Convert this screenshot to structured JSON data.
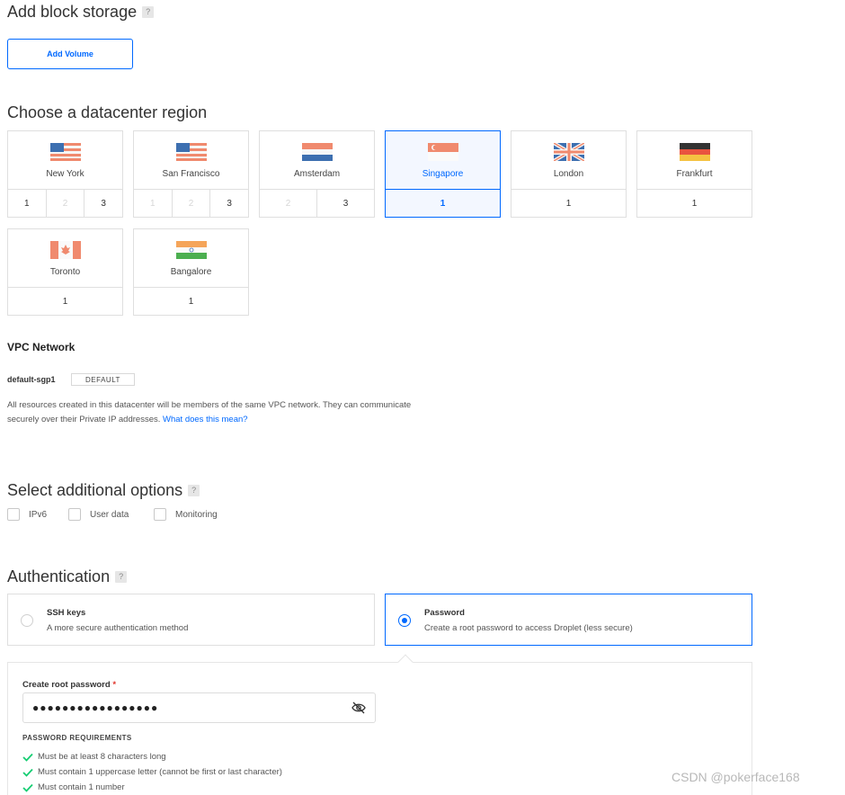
{
  "block_storage": {
    "title": "Add block storage",
    "help": "?",
    "add_volume_label": "Add Volume"
  },
  "datacenter": {
    "title": "Choose a datacenter region",
    "regions": [
      {
        "name": "New York",
        "flag": "us-flag",
        "numbers": [
          "1",
          "2",
          "3"
        ],
        "disabled": [
          false,
          true,
          false
        ],
        "selected": false
      },
      {
        "name": "San Francisco",
        "flag": "us-flag",
        "numbers": [
          "1",
          "2",
          "3"
        ],
        "disabled": [
          true,
          true,
          false
        ],
        "selected": false
      },
      {
        "name": "Amsterdam",
        "flag": "netherlands-flag",
        "numbers": [
          "2",
          "3"
        ],
        "disabled": [
          true,
          false
        ],
        "selected": false
      },
      {
        "name": "Singapore",
        "flag": "singapore-flag",
        "numbers": [
          "1"
        ],
        "disabled": [
          false
        ],
        "selected": true
      },
      {
        "name": "London",
        "flag": "uk-flag",
        "numbers": [
          "1"
        ],
        "disabled": [
          false
        ],
        "selected": false
      },
      {
        "name": "Frankfurt",
        "flag": "germany-flag",
        "numbers": [
          "1"
        ],
        "disabled": [
          false
        ],
        "selected": false
      },
      {
        "name": "Toronto",
        "flag": "canada-flag",
        "numbers": [
          "1"
        ],
        "disabled": [
          false
        ],
        "selected": false
      },
      {
        "name": "Bangalore",
        "flag": "india-flag",
        "numbers": [
          "1"
        ],
        "disabled": [
          false
        ],
        "selected": false
      }
    ]
  },
  "vpc": {
    "title": "VPC Network",
    "network_name": "default-sgp1",
    "badge": "DEFAULT",
    "description": "All resources created in this datacenter will be members of the same VPC network. They can communicate securely over their Private IP addresses.",
    "link": "What does this mean?"
  },
  "options": {
    "title": "Select additional options",
    "help": "?",
    "items": [
      "IPv6",
      "User data",
      "Monitoring"
    ]
  },
  "auth": {
    "title": "Authentication",
    "help": "?",
    "ssh": {
      "title": "SSH keys",
      "desc": "A more secure authentication method",
      "selected": false
    },
    "password": {
      "title": "Password",
      "desc": "Create a root password to access Droplet (less secure)",
      "selected": true
    },
    "pw_label": "Create root password",
    "pw_required_mark": "*",
    "pw_value": "●●●●●●●●●●●●●●●●●",
    "requirements_title": "PASSWORD REQUIREMENTS",
    "requirements": [
      "Must be at least 8 characters long",
      "Must contain 1 uppercase letter (cannot be first or last character)",
      "Must contain 1 number"
    ]
  },
  "watermark": "CSDN @pokerface168",
  "colors": {
    "accent": "#0069ff",
    "check": "#15cd72",
    "border": "#dfdfdf"
  }
}
